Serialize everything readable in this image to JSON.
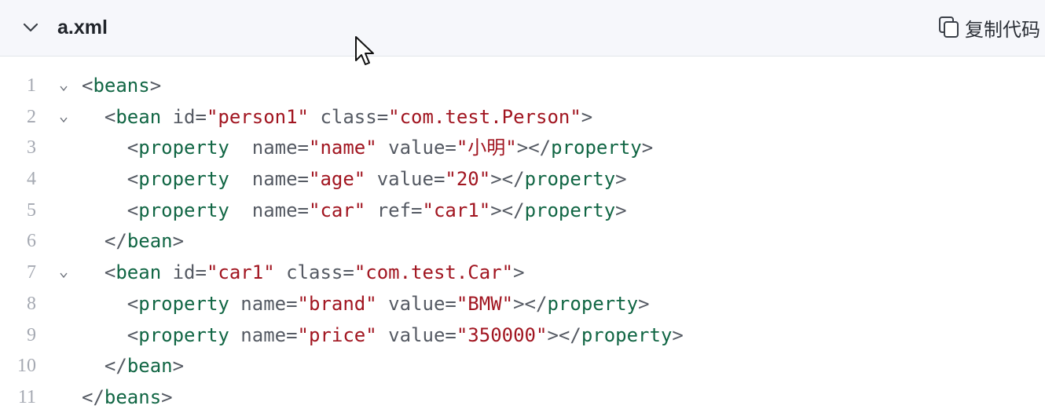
{
  "header": {
    "filename": "a.xml",
    "copy_label": "复制代码"
  },
  "code": {
    "lines": [
      {
        "num": "1",
        "fold": true,
        "indent": "",
        "tokens": [
          [
            "punc",
            "<"
          ],
          [
            "tag",
            "beans"
          ],
          [
            "punc",
            ">"
          ]
        ]
      },
      {
        "num": "2",
        "fold": true,
        "indent": "  ",
        "tokens": [
          [
            "punc",
            "<"
          ],
          [
            "tag",
            "bean"
          ],
          [
            "attr",
            " id="
          ],
          [
            "str",
            "\"person1\""
          ],
          [
            "attr",
            " class="
          ],
          [
            "str",
            "\"com.test.Person\""
          ],
          [
            "punc",
            ">"
          ]
        ]
      },
      {
        "num": "3",
        "fold": false,
        "indent": "    ",
        "tokens": [
          [
            "punc",
            "<"
          ],
          [
            "tag",
            "property"
          ],
          [
            "attr",
            "  name="
          ],
          [
            "str",
            "\"name\""
          ],
          [
            "attr",
            " value="
          ],
          [
            "str",
            "\"小明\""
          ],
          [
            "punc",
            "></"
          ],
          [
            "tag",
            "property"
          ],
          [
            "punc",
            ">"
          ]
        ]
      },
      {
        "num": "4",
        "fold": false,
        "indent": "    ",
        "tokens": [
          [
            "punc",
            "<"
          ],
          [
            "tag",
            "property"
          ],
          [
            "attr",
            "  name="
          ],
          [
            "str",
            "\"age\""
          ],
          [
            "attr",
            " value="
          ],
          [
            "str",
            "\"20\""
          ],
          [
            "punc",
            "></"
          ],
          [
            "tag",
            "property"
          ],
          [
            "punc",
            ">"
          ]
        ]
      },
      {
        "num": "5",
        "fold": false,
        "indent": "    ",
        "tokens": [
          [
            "punc",
            "<"
          ],
          [
            "tag",
            "property"
          ],
          [
            "attr",
            "  name="
          ],
          [
            "str",
            "\"car\""
          ],
          [
            "attr",
            " ref="
          ],
          [
            "str",
            "\"car1\""
          ],
          [
            "punc",
            "></"
          ],
          [
            "tag",
            "property"
          ],
          [
            "punc",
            ">"
          ]
        ]
      },
      {
        "num": "6",
        "fold": false,
        "indent": "  ",
        "tokens": [
          [
            "punc",
            "</"
          ],
          [
            "tag",
            "bean"
          ],
          [
            "punc",
            ">"
          ]
        ]
      },
      {
        "num": "7",
        "fold": true,
        "indent": "  ",
        "tokens": [
          [
            "punc",
            "<"
          ],
          [
            "tag",
            "bean"
          ],
          [
            "attr",
            " id="
          ],
          [
            "str",
            "\"car1\""
          ],
          [
            "attr",
            " class="
          ],
          [
            "str",
            "\"com.test.Car\""
          ],
          [
            "punc",
            ">"
          ]
        ]
      },
      {
        "num": "8",
        "fold": false,
        "indent": "    ",
        "tokens": [
          [
            "punc",
            "<"
          ],
          [
            "tag",
            "property"
          ],
          [
            "attr",
            " name="
          ],
          [
            "str",
            "\"brand\""
          ],
          [
            "attr",
            " value="
          ],
          [
            "str",
            "\"BMW\""
          ],
          [
            "punc",
            "></"
          ],
          [
            "tag",
            "property"
          ],
          [
            "punc",
            ">"
          ]
        ]
      },
      {
        "num": "9",
        "fold": false,
        "indent": "    ",
        "tokens": [
          [
            "punc",
            "<"
          ],
          [
            "tag",
            "property"
          ],
          [
            "attr",
            " name="
          ],
          [
            "str",
            "\"price\""
          ],
          [
            "attr",
            " value="
          ],
          [
            "str",
            "\"350000\""
          ],
          [
            "punc",
            "></"
          ],
          [
            "tag",
            "property"
          ],
          [
            "punc",
            ">"
          ]
        ]
      },
      {
        "num": "10",
        "fold": false,
        "indent": "  ",
        "tokens": [
          [
            "punc",
            "</"
          ],
          [
            "tag",
            "bean"
          ],
          [
            "punc",
            ">"
          ]
        ]
      },
      {
        "num": "11",
        "fold": false,
        "indent": "",
        "tokens": [
          [
            "punc",
            "</"
          ],
          [
            "tag",
            "beans"
          ],
          [
            "punc",
            ">"
          ]
        ]
      }
    ]
  },
  "colors": {
    "tag": "#116644",
    "attribute": "#555a63",
    "string": "#a11520",
    "line_number": "#a5a9b2",
    "header_bg": "#f6f7fb"
  },
  "icons": {
    "collapse": "chevron-down-icon",
    "copy": "copy-icon",
    "fold": "fold-chevron-icon",
    "cursor": "mouse-pointer-icon"
  }
}
